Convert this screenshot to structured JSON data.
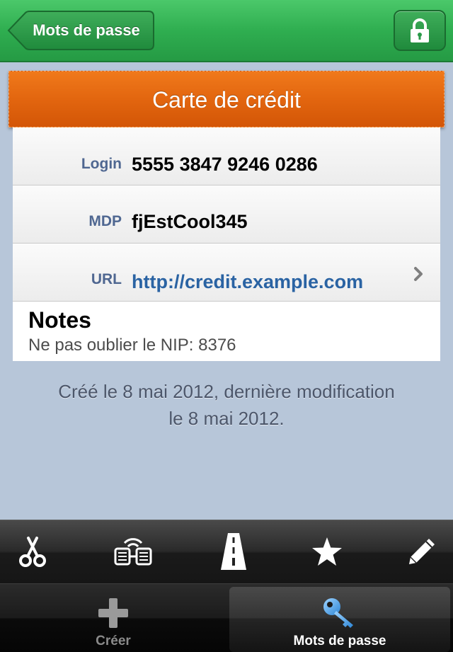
{
  "navbar": {
    "back_label": "Mots de passe",
    "lock_icon": "lock-icon"
  },
  "entry": {
    "title": "Carte de crédit",
    "fields": [
      {
        "key": "Login",
        "value": "5555 3847 9246 0286"
      },
      {
        "key": "MDP",
        "value": "fjEstCool345"
      },
      {
        "key": "URL",
        "value": "http://credit.example.com"
      }
    ],
    "notes_title": "Notes",
    "notes_text": "Ne pas oublier le NIP: 8376",
    "footer_line1": "Créé le 8 mai 2012, dernière modification",
    "footer_line2": "le 8 mai 2012."
  },
  "toolbar": {
    "tools": [
      "scissors-icon",
      "sync-icon",
      "road-icon",
      "star-icon",
      "pencil-icon"
    ]
  },
  "tabbar": {
    "tabs": [
      {
        "label": "Créer",
        "icon": "plus-icon",
        "selected": false
      },
      {
        "label": "Mots de passe",
        "icon": "key-icon",
        "selected": true
      }
    ]
  },
  "colors": {
    "nav_green": "#2fae50",
    "header_orange": "#e1640e",
    "background": "#b7c6d9",
    "link_blue": "#2a63a3",
    "key_label": "#4f6791"
  }
}
